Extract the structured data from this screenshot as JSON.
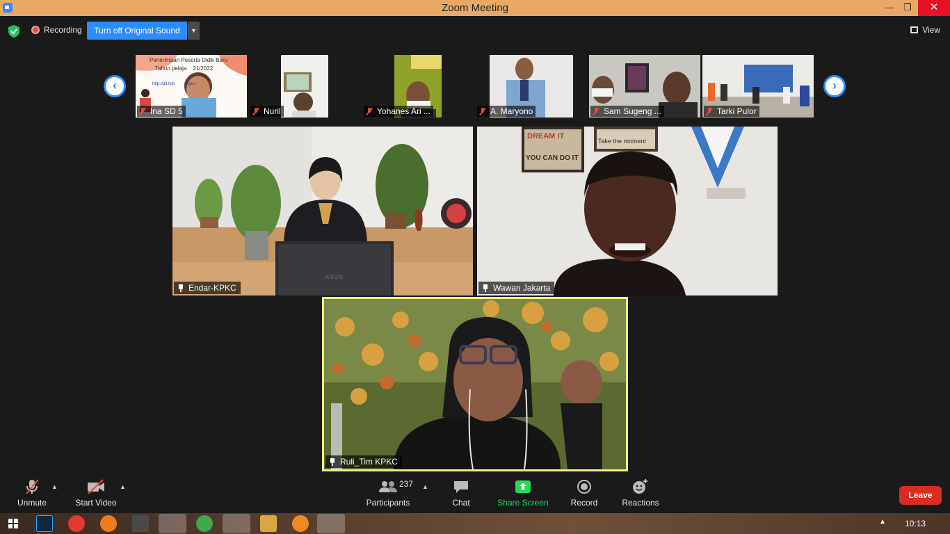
{
  "window": {
    "title": "Zoom Meeting",
    "minimize": "—",
    "maximize": "❐",
    "close": "✕"
  },
  "topbar": {
    "recording_label": "Recording",
    "original_sound_button": "Turn off Original Sound",
    "view_label": "View"
  },
  "thumbnails": [
    {
      "name": "Ina SD 5",
      "muted": true,
      "slide_title": "Penerimaan Peserta Didik Baru",
      "slide_sub": "Tahun pelaja    21/2022",
      "slide_link": "http://bit.ly/p        angun"
    },
    {
      "name": "Nuril",
      "muted": true
    },
    {
      "name": "Yohanes Ari ...",
      "muted": true
    },
    {
      "name": "A. Maryono",
      "muted": true
    },
    {
      "name": "Sam Sugeng ...",
      "muted": true
    },
    {
      "name": "Tarki Pulor",
      "muted": true
    }
  ],
  "gallery": [
    {
      "name": "Endar-KPKC",
      "laptop_brand": "ASUS"
    },
    {
      "name": "Wawan Jakarta",
      "sign_text_1": "DREAM IT",
      "sign_text_2": "YOU CAN DO IT",
      "sign_text_3": "Take the moment"
    },
    {
      "name": "Ruli_Tim KPKC",
      "speaking": true
    }
  ],
  "toolbar": {
    "unmute": "Unmute",
    "start_video": "Start Video",
    "participants": "Participants",
    "participants_count": "237",
    "chat": "Chat",
    "share_screen": "Share Screen",
    "record": "Record",
    "reactions": "Reactions",
    "leave": "Leave"
  },
  "taskbar": {
    "time": "10:13"
  },
  "colors": {
    "accent": "#2d8cff",
    "share_green": "#23d959",
    "leave_red": "#d92d21",
    "active_speaker": "#f2f27a",
    "titlebar": "#e8a966"
  }
}
